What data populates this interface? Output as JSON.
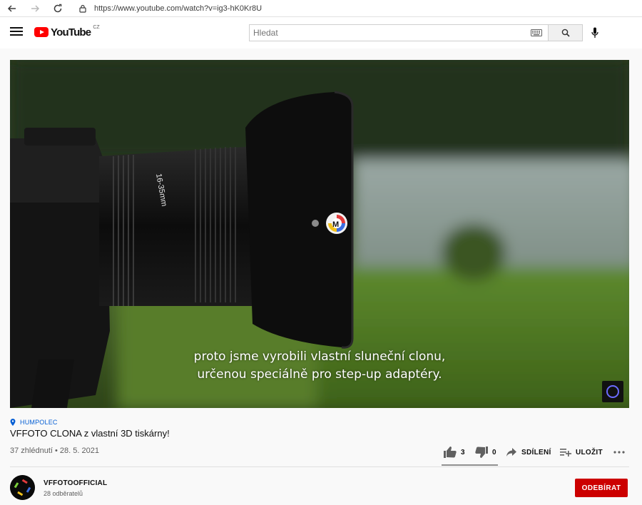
{
  "browser": {
    "url": "https://www.youtube.com/watch?v=ig3-hK0Kr8U"
  },
  "header": {
    "logo_text": "YouTube",
    "country_code": "CZ",
    "search_placeholder": "Hledat",
    "icons": [
      "menu-icon",
      "keyboard-icon",
      "search-icon",
      "mic-icon"
    ]
  },
  "video": {
    "caption_line1": "proto jsme vyrobili vlastní sluneční clonu,",
    "caption_line2": "určenou speciálně pro step-up adaptéry.",
    "lens_text": "16-35mm"
  },
  "info": {
    "location": "HUMPOLEC",
    "title": "VFFOTO CLONA z vlastní 3D tiskárny!",
    "meta": "37 zhlédnutí • 28. 5. 2021",
    "likes": "3",
    "dislikes": "0",
    "share_label": "SDÍLENÍ",
    "save_label": "ULOŽIT"
  },
  "channel": {
    "name": "VFFOTOOFFICIAL",
    "subscribers": "28 odběratelů",
    "subscribe_label": "ODEBÍRAT"
  },
  "colors": {
    "brand_red": "#ff0000",
    "subscribe_red": "#cc0000",
    "link_blue": "#065fd4"
  }
}
